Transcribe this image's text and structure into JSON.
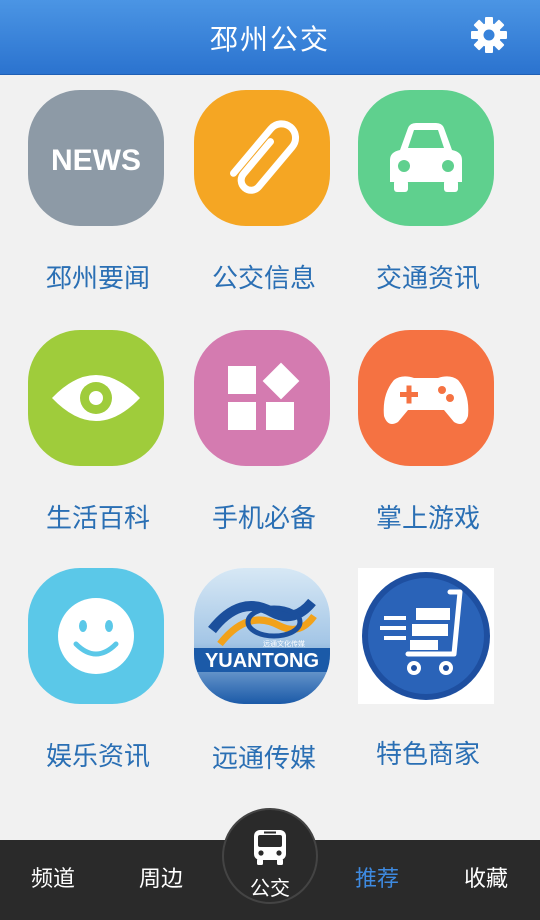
{
  "header": {
    "title": "邳州公交",
    "settings_icon": "gear-icon"
  },
  "grid": {
    "items": [
      {
        "label": "邳州要闻",
        "icon": "news-icon",
        "icon_text": "NEWS",
        "color": "#8d9aa6"
      },
      {
        "label": "公交信息",
        "icon": "paperclip-icon",
        "color": "#f5a623"
      },
      {
        "label": "交通资讯",
        "icon": "car-icon",
        "color": "#5fd08e"
      },
      {
        "label": "生活百科",
        "icon": "eye-icon",
        "color": "#9fcc3b"
      },
      {
        "label": "手机必备",
        "icon": "apps-icon",
        "color": "#d47bb0"
      },
      {
        "label": "掌上游戏",
        "icon": "gamepad-icon",
        "color": "#f57242"
      },
      {
        "label": "娱乐资讯",
        "icon": "smiley-icon",
        "color": "#5bc8e8"
      },
      {
        "label": "远通传媒",
        "icon": "yuantong-logo",
        "icon_text": "YUANTONG",
        "icon_subtext": "远通文化传媒",
        "color": "#1b5aa8"
      },
      {
        "label": "特色商家",
        "icon": "shopping-cart-icon",
        "color": "#1e4fa0"
      }
    ]
  },
  "tabbar": {
    "tabs": [
      {
        "label": "频道",
        "active": false
      },
      {
        "label": "周边",
        "active": false
      },
      {
        "label": "推荐",
        "active": true
      },
      {
        "label": "收藏",
        "active": false
      }
    ],
    "center": {
      "label": "公交",
      "icon": "bus-icon"
    },
    "active_color": "#3e8ae0"
  }
}
